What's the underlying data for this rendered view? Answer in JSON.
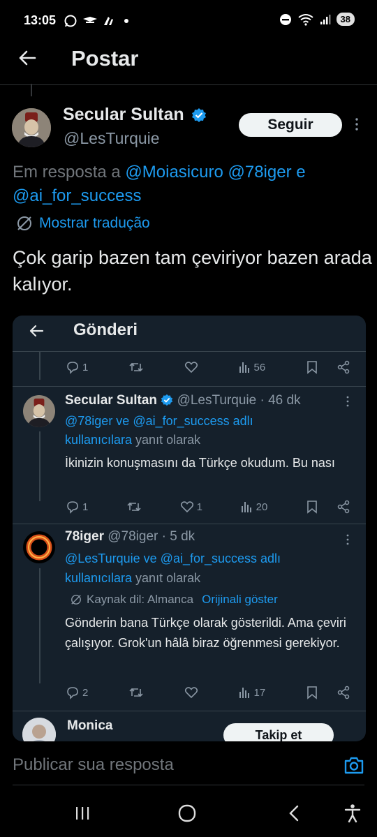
{
  "status": {
    "time": "13:05",
    "battery": "38"
  },
  "header": {
    "title": "Postar"
  },
  "tweet": {
    "author_name": "Secular Sultan",
    "author_handle": "@LesTurquie",
    "follow_label": "Seguir",
    "reply_prefix": "Em resposta a ",
    "reply_mentions_1": "@Moiasicuro @78iger e",
    "reply_mentions_2": "@ai_for_success",
    "translate_label": "Mostrar tradução",
    "text": "Çok garip bazen tam çeviriyor bazen arada kalıyor."
  },
  "embed": {
    "title": "Gönderi",
    "top_actions": {
      "replies": "1",
      "views": "56"
    },
    "post1": {
      "name": "Secular Sultan",
      "handle_time": "@LesTurquie · 46 dk",
      "reply_line1": "@78iger ve @ai_for_success adlı",
      "reply_line2_link": "kullanıcılara",
      "reply_line2_rest": " yanıt olarak",
      "text": "İkinizin konuşmasını da Türkçe okudum. Bu nası",
      "replies": "1",
      "likes": "1",
      "views": "20"
    },
    "post2": {
      "name": "78iger",
      "handle_time": "@78iger · 5 dk",
      "reply_line1": "@LesTurquie ve @ai_for_success adlı",
      "reply_line2_link": "kullanıcılara",
      "reply_line2_rest": " yanıt olarak",
      "source_lang": "Kaynak dil: Almanca",
      "show_original": "Orijinali göster",
      "text": "Gönderin bana Türkçe olarak gösterildi. Ama çeviri çalışıyor. Grok'un hâlâ biraz öğrenmesi gerekiyor.",
      "replies": "2",
      "views": "17"
    },
    "post3": {
      "name": "Monica",
      "follow_label": "Takip et"
    }
  },
  "reply_bar": {
    "placeholder": "Publicar sua resposta"
  },
  "colors": {
    "accent": "#1d9bf0",
    "background": "#000000",
    "embed_bg": "#15202b"
  }
}
